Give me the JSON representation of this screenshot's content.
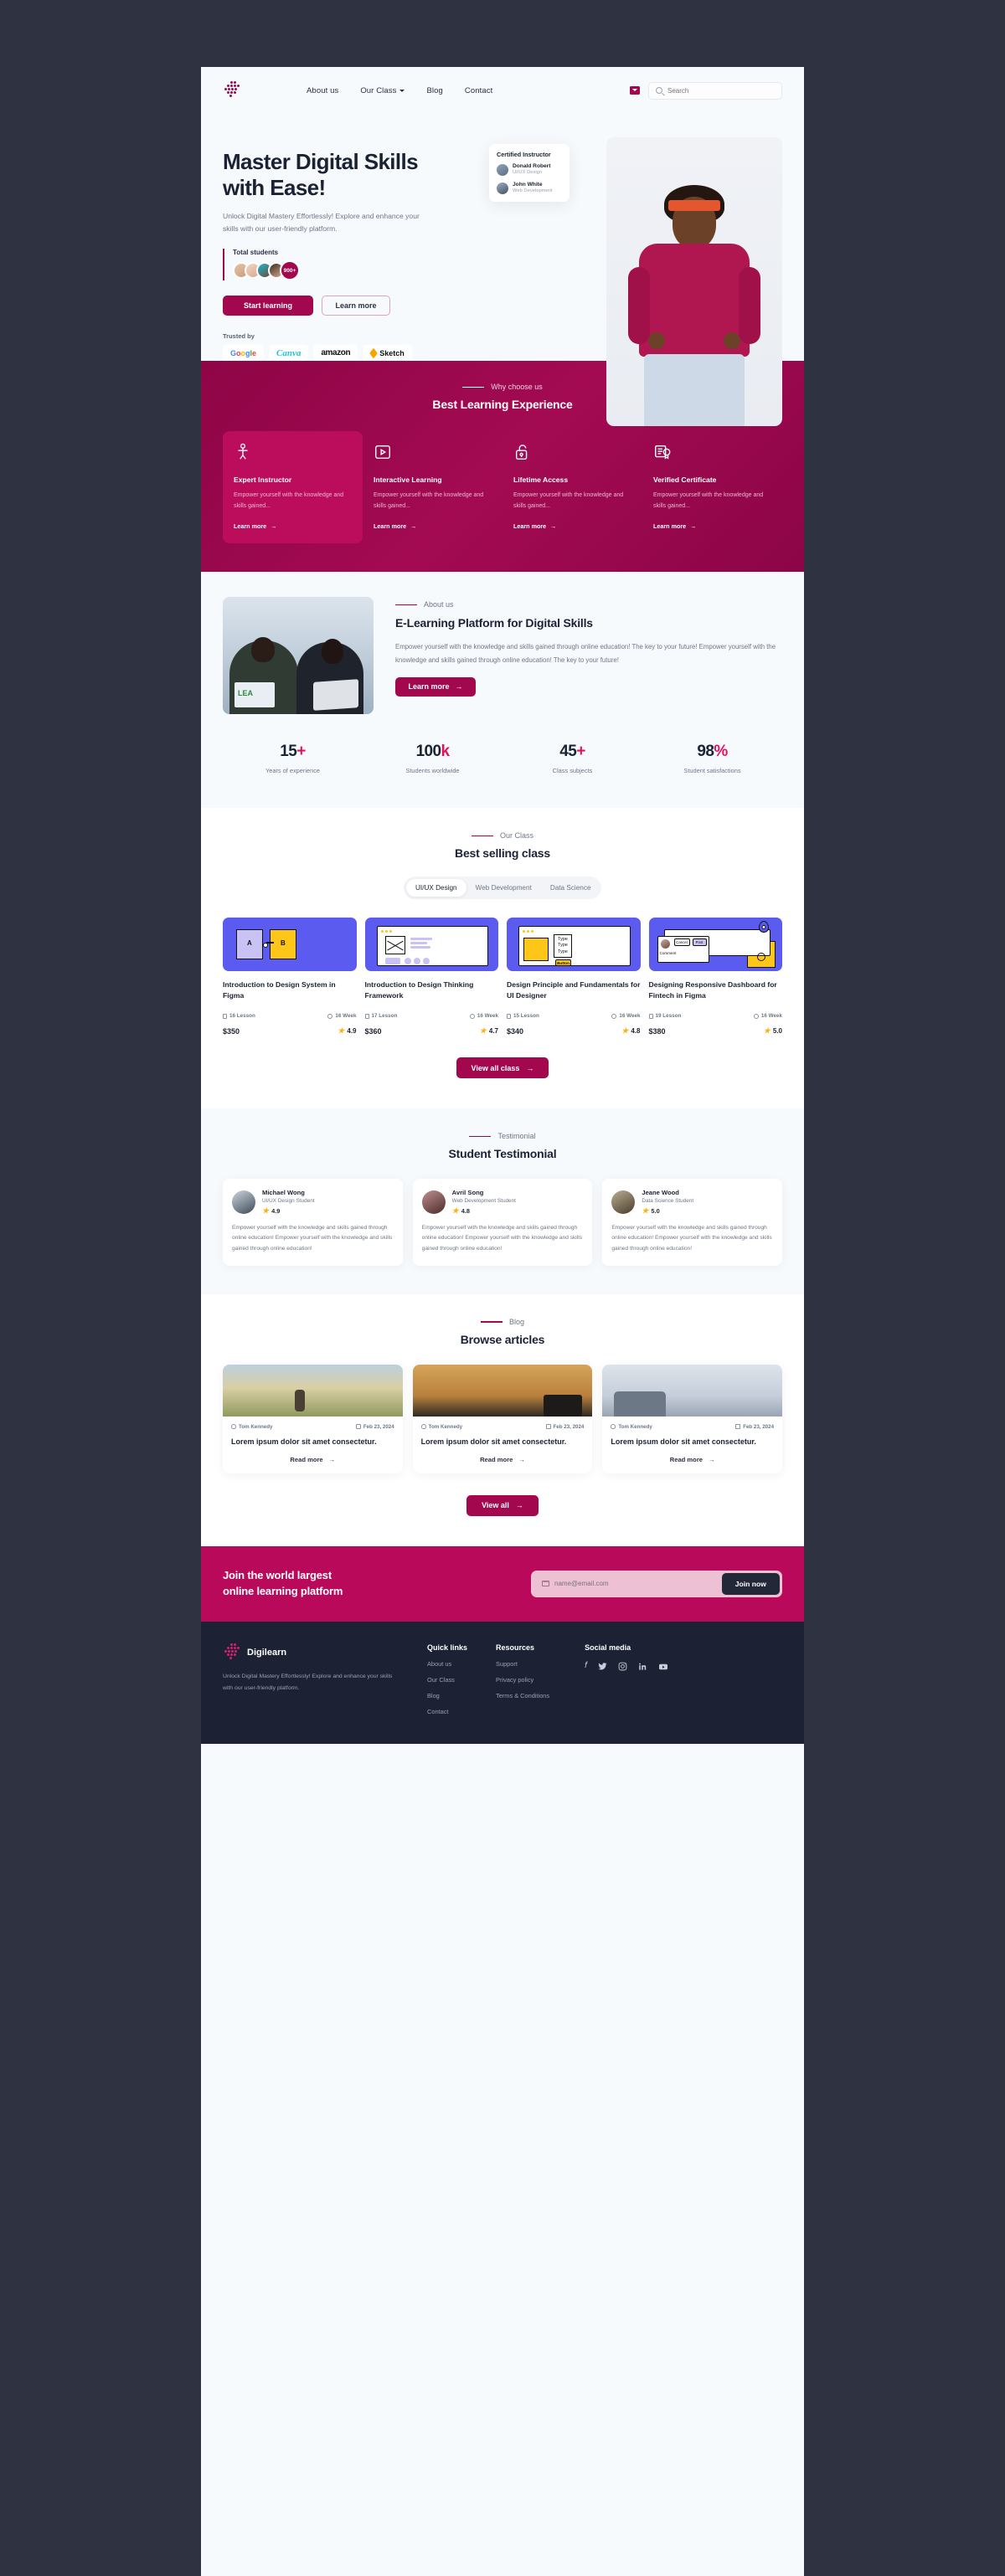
{
  "brand": {
    "name": "Digilearn"
  },
  "header": {
    "nav": [
      {
        "label": "About us",
        "caret": false
      },
      {
        "label": "Our Class",
        "caret": true
      },
      {
        "label": "Blog",
        "caret": false
      },
      {
        "label": "Contact",
        "caret": false
      }
    ],
    "search_placeholder": "Search"
  },
  "hero": {
    "title_line1": "Master Digital Skills",
    "title_line2": "with Ease!",
    "subtitle": "Unlock Digital Mastery Effortlessly! Explore and enhance your skills with our user-friendly platform.",
    "total_students_label": "Total students",
    "students_count": "900+",
    "cta_primary": "Start learning",
    "cta_secondary": "Learn more",
    "trusted_label": "Trusted by",
    "brands": [
      "Google",
      "Canva",
      "amazon",
      "Sketch"
    ],
    "instructor_card": {
      "title": "Certified Instructor",
      "people": [
        {
          "name": "Donald Robert",
          "role": "UI/UX Design"
        },
        {
          "name": "John White",
          "role": "Web Development"
        }
      ]
    }
  },
  "why": {
    "eyebrow": "Why choose us",
    "title": "Best Learning Experience",
    "features": [
      {
        "icon": "person-icon",
        "title": "Expert Instructor",
        "desc": "Empower yourself with the knowledge and skills gained...",
        "link": "Learn more"
      },
      {
        "icon": "play-square-icon",
        "title": "Interactive Learning",
        "desc": "Empower yourself with the knowledge and skills gained...",
        "link": "Learn more"
      },
      {
        "icon": "unlock-icon",
        "title": "Lifetime Access",
        "desc": "Empower yourself with the knowledge and skills gained...",
        "link": "Learn more"
      },
      {
        "icon": "certificate-icon",
        "title": "Verified Certificate",
        "desc": "Empower yourself with the knowledge and skills gained...",
        "link": "Learn more"
      }
    ]
  },
  "about": {
    "eyebrow": "About us",
    "title": "E-Learning Platform for Digital Skills",
    "body": "Empower yourself with the knowledge and skills gained through online education! The key to your future! Empower yourself with the knowledge and skills gained through online education! The key to your future!",
    "cta": "Learn more"
  },
  "stats": [
    {
      "value": "15",
      "suffix": "+",
      "caption": "Years of experience"
    },
    {
      "value": "100",
      "suffix": "k",
      "caption": "Students worldwide"
    },
    {
      "value": "45",
      "suffix": "+",
      "caption": "Class subjects"
    },
    {
      "value": "98",
      "suffix": "%",
      "caption": "Student satisfactions"
    }
  ],
  "classes": {
    "eyebrow": "Our Class",
    "title": "Best selling class",
    "tabs": [
      {
        "label": "UI/UX Design",
        "active": true
      },
      {
        "label": "Web Development",
        "active": false
      },
      {
        "label": "Data Science",
        "active": false
      }
    ],
    "cards": [
      {
        "title": "Introduction to Design System in Figma",
        "lessons": "16 Lesson",
        "weeks": "16 Week",
        "price": "$350",
        "rating": "4.9"
      },
      {
        "title": "Introduction to Design Thinking Framework",
        "lessons": "17 Lesson",
        "weeks": "16 Week",
        "price": "$360",
        "rating": "4.7"
      },
      {
        "title": "Design Principle and Fundamentals for UI Designer",
        "lessons": "15 Lesson",
        "weeks": "16 Week",
        "price": "$340",
        "rating": "4.8"
      },
      {
        "title": "Designing Responsive Dashboard for Fintech in Figma",
        "lessons": "19 Lesson",
        "weeks": "16 Week",
        "price": "$380",
        "rating": "5.0"
      }
    ],
    "thumb_labels": {
      "a": "A",
      "b": "B",
      "type": "Type",
      "button": "Button",
      "comment": "Comment",
      "cancel": "Cancel",
      "post": "Post"
    },
    "view_all": "View all class"
  },
  "testimonial": {
    "eyebrow": "Testimonial",
    "title": "Student Testimonial",
    "cards": [
      {
        "name": "Michael Wong",
        "role": "UI/UX Design Student",
        "rating": "4.9",
        "body": "Empower yourself with the knowledge and skills gained through online education! Empower yourself with the knowledge and skills gained through online education!"
      },
      {
        "name": "Avril Song",
        "role": "Web Development Student",
        "rating": "4.8",
        "body": "Empower yourself with the knowledge and skills gained through online education! Empower yourself with the knowledge and skills gained through online education!"
      },
      {
        "name": "Jeane Wood",
        "role": "Data Science Student",
        "rating": "5.0",
        "body": "Empower yourself with the knowledge and skills gained through online education! Empower yourself with the knowledge and skills gained through online education!"
      }
    ]
  },
  "blog": {
    "eyebrow": "Blog",
    "title": "Browse articles",
    "posts": [
      {
        "author": "Tom Kennedy",
        "date": "Feb 23, 2024",
        "title": "Lorem ipsum dolor sit amet consectetur.",
        "read": "Read more"
      },
      {
        "author": "Tom Kennedy",
        "date": "Feb 23, 2024",
        "title": "Lorem ipsum dolor sit amet consectetur.",
        "read": "Read more"
      },
      {
        "author": "Tom Kennedy",
        "date": "Feb 23, 2024",
        "title": "Lorem ipsum dolor sit amet consectetur.",
        "read": "Read more"
      }
    ],
    "view_all": "View all"
  },
  "cta": {
    "title_line1": "Join the world largest",
    "title_line2": "online learning platform",
    "email_placeholder": "name@email.com",
    "button": "Join now"
  },
  "footer": {
    "brand": "Digilearn",
    "desc": "Unlock Digital Mastery Effortlessly! Explore and enhance your skills with our user-friendly platform.",
    "quick_links": {
      "heading": "Quick links",
      "items": [
        "About us",
        "Our Class",
        "Blog",
        "Contact"
      ]
    },
    "resources": {
      "heading": "Resources",
      "items": [
        "Support",
        "Privacy policy",
        "Terms & Conditions"
      ]
    },
    "social": {
      "heading": "Social media",
      "items": [
        "facebook-icon",
        "twitter-icon",
        "instagram-icon",
        "linkedin-icon",
        "youtube-icon"
      ]
    }
  },
  "colors": {
    "primary": "#a3084f",
    "accent": "#e0115f",
    "dark": "#1c2233",
    "page_bg": "#f7fafc",
    "canvas": "#2e3241"
  }
}
